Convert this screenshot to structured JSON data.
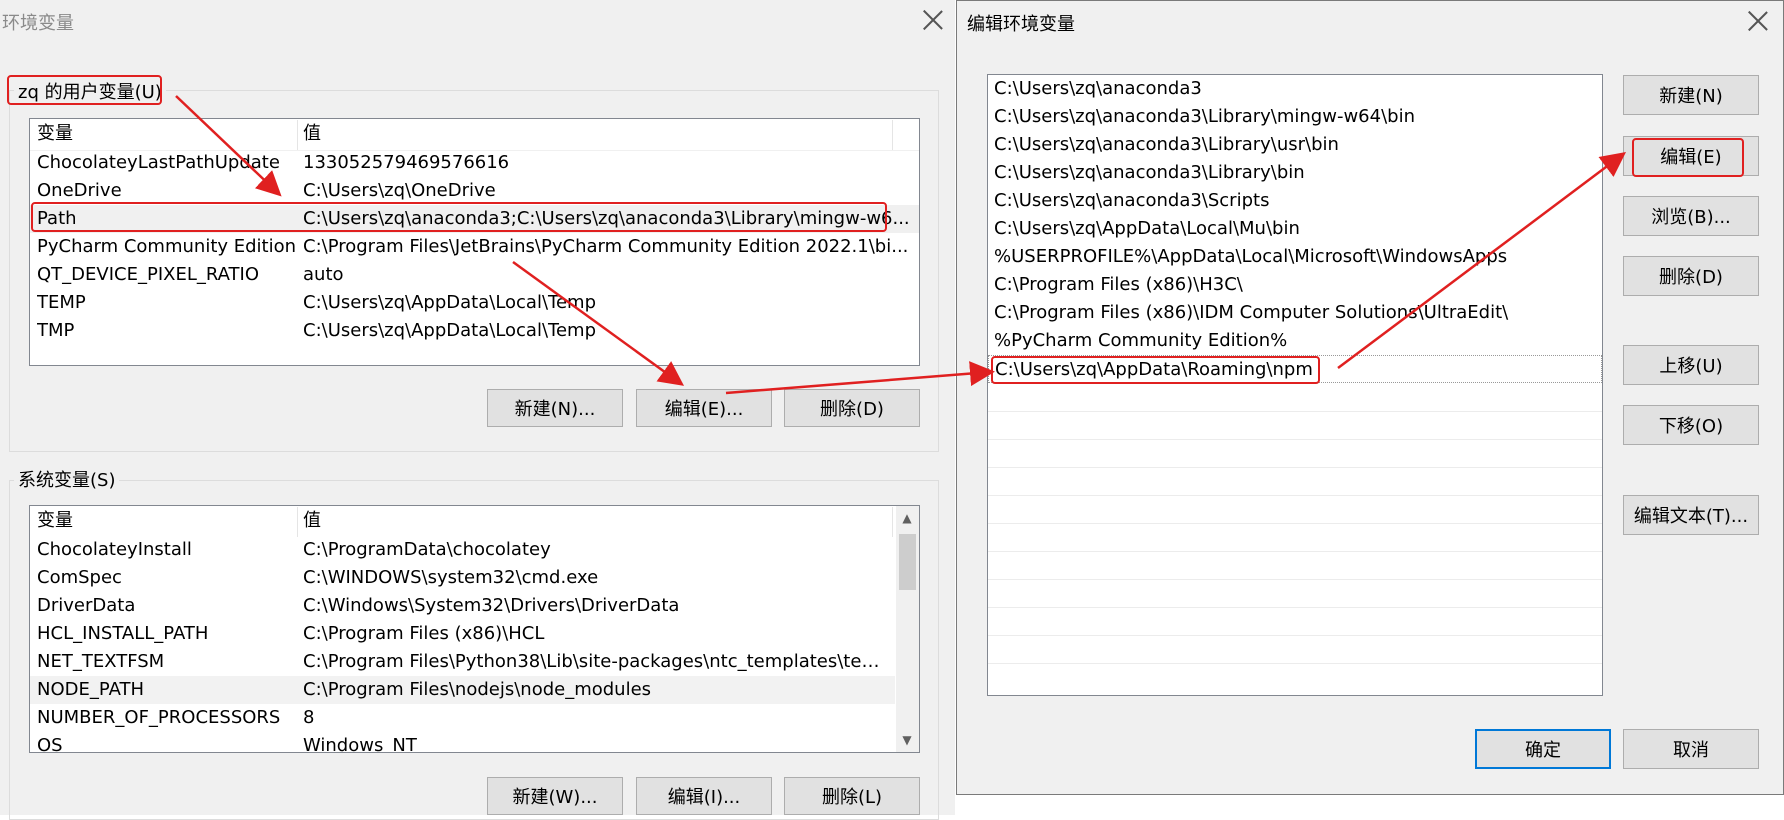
{
  "env_dialog": {
    "title": "环境变量",
    "user_vars": {
      "label": "zq 的用户变量(U)",
      "col_variable": "变量",
      "col_value": "值",
      "rows": [
        {
          "name": "ChocolateyLastPathUpdate",
          "value": "133052579469576616"
        },
        {
          "name": "OneDrive",
          "value": "C:\\Users\\zq\\OneDrive"
        },
        {
          "name": "Path",
          "value": "C:\\Users\\zq\\anaconda3;C:\\Users\\zq\\anaconda3\\Library\\mingw-w6..."
        },
        {
          "name": "PyCharm Community Edition",
          "value": "C:\\Program Files\\JetBrains\\PyCharm Community Edition 2022.1\\bi..."
        },
        {
          "name": "QT_DEVICE_PIXEL_RATIO",
          "value": "auto"
        },
        {
          "name": "TEMP",
          "value": "C:\\Users\\zq\\AppData\\Local\\Temp"
        },
        {
          "name": "TMP",
          "value": "C:\\Users\\zq\\AppData\\Local\\Temp"
        }
      ],
      "buttons": {
        "new": "新建(N)...",
        "edit": "编辑(E)...",
        "delete": "删除(D)"
      }
    },
    "system_vars": {
      "label": "系统变量(S)",
      "col_variable": "变量",
      "col_value": "值",
      "rows": [
        {
          "name": "ChocolateyInstall",
          "value": "C:\\ProgramData\\chocolatey"
        },
        {
          "name": "ComSpec",
          "value": "C:\\WINDOWS\\system32\\cmd.exe"
        },
        {
          "name": "DriverData",
          "value": "C:\\Windows\\System32\\Drivers\\DriverData"
        },
        {
          "name": "HCL_INSTALL_PATH",
          "value": "C:\\Program Files (x86)\\HCL"
        },
        {
          "name": "NET_TEXTFSM",
          "value": "C:\\Program Files\\Python38\\Lib\\site-packages\\ntc_templates\\temp..."
        },
        {
          "name": "NODE_PATH",
          "value": "C:\\Program Files\\nodejs\\node_modules"
        },
        {
          "name": "NUMBER_OF_PROCESSORS",
          "value": "8"
        },
        {
          "name": "OS",
          "value": "Windows_NT"
        }
      ],
      "buttons": {
        "new": "新建(W)...",
        "edit": "编辑(I)...",
        "delete": "删除(L)"
      }
    }
  },
  "edit_dialog": {
    "title": "编辑环境变量",
    "paths": [
      "C:\\Users\\zq\\anaconda3",
      "C:\\Users\\zq\\anaconda3\\Library\\mingw-w64\\bin",
      "C:\\Users\\zq\\anaconda3\\Library\\usr\\bin",
      "C:\\Users\\zq\\anaconda3\\Library\\bin",
      "C:\\Users\\zq\\anaconda3\\Scripts",
      "C:\\Users\\zq\\AppData\\Local\\Mu\\bin",
      "%USERPROFILE%\\AppData\\Local\\Microsoft\\WindowsApps",
      "C:\\Program Files (x86)\\H3C\\",
      "C:\\Program Files (x86)\\IDM Computer Solutions\\UltraEdit\\",
      "%PyCharm Community Edition%",
      "C:\\Users\\zq\\AppData\\Roaming\\npm"
    ],
    "buttons": {
      "new": "新建(N)",
      "edit": "编辑(E)",
      "browse": "浏览(B)...",
      "delete": "删除(D)",
      "move_up": "上移(U)",
      "move_down": "下移(O)",
      "edit_text": "编辑文本(T)...",
      "ok": "确定",
      "cancel": "取消"
    }
  },
  "annotation_color": "#e02020",
  "icons": {
    "close": "close-icon",
    "scroll_up": "scroll-up-arrow-icon",
    "scroll_down": "scroll-down-arrow-icon"
  }
}
